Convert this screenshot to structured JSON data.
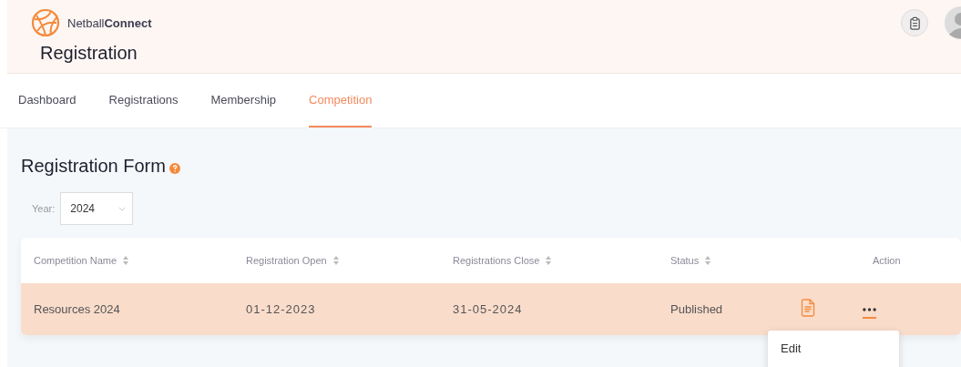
{
  "brand": {
    "name": "Netball**Connect**"
  },
  "page_title": "Registration",
  "tabs": [
    {
      "label": "Dashboard",
      "selected": false
    },
    {
      "label": "Registrations",
      "selected": false
    },
    {
      "label": "Membership",
      "selected": false
    },
    {
      "label": "Competition",
      "selected": true
    }
  ],
  "section": {
    "title": "Registration Form"
  },
  "year_filter": {
    "label": "Year:",
    "value": "2024"
  },
  "table": {
    "columns": [
      {
        "label": "Competition Name",
        "sortable": true
      },
      {
        "label": "Registration Open",
        "sortable": true
      },
      {
        "label": "Registrations Close",
        "sortable": true
      },
      {
        "label": "Status",
        "sortable": true
      },
      {
        "label": "Action",
        "sortable": false
      }
    ],
    "rows": [
      {
        "cells": [
          "Resources 2024",
          "01-12-2023",
          "31-05-2024",
          "Published"
        ],
        "selected": true
      }
    ]
  },
  "action_menu": {
    "items": [
      "Edit"
    ]
  }
}
